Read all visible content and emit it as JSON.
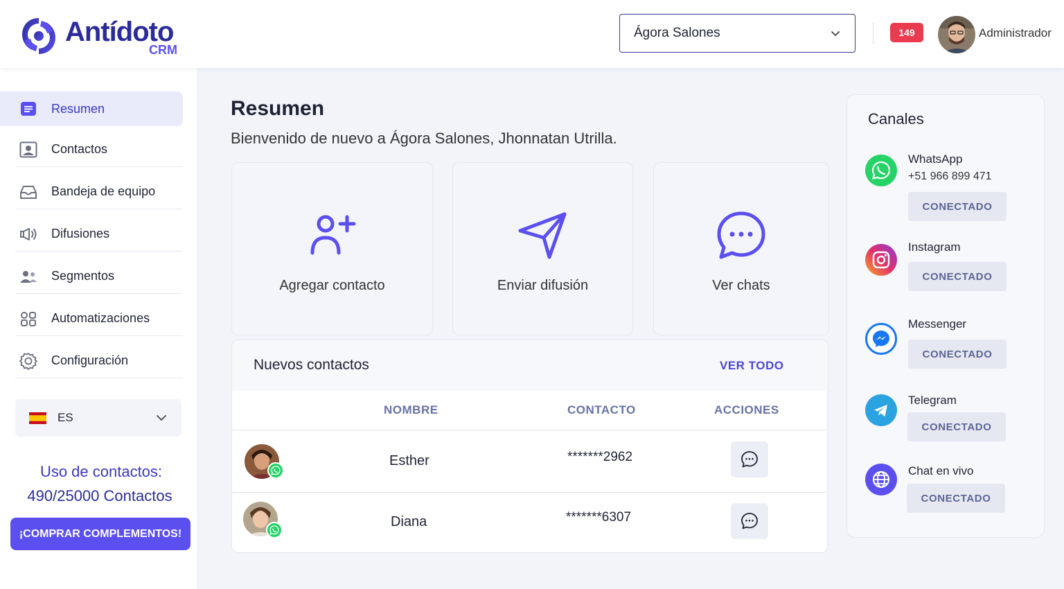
{
  "header": {
    "brand_name": "Antídoto",
    "brand_sub": "CRM",
    "salon_selected": "Ágora Salones",
    "notifications_count": "149",
    "user_name": "Administrador"
  },
  "sidebar": {
    "items": [
      {
        "label": "Resumen",
        "icon": "summary-icon"
      },
      {
        "label": "Contactos",
        "icon": "contacts-icon"
      },
      {
        "label": "Bandeja de equipo",
        "icon": "inbox-icon"
      },
      {
        "label": "Difusiones",
        "icon": "broadcast-icon"
      },
      {
        "label": "Segmentos",
        "icon": "segments-icon"
      },
      {
        "label": "Automatizaciones",
        "icon": "automations-icon"
      },
      {
        "label": "Configuración",
        "icon": "gear-icon"
      }
    ],
    "language_code": "ES",
    "usage_title": "Uso de contactos:",
    "usage_count": "490/25000 Contactos",
    "buy_button": "¡COMPRAR COMPLEMENTOS!"
  },
  "main": {
    "title": "Resumen",
    "welcome": "Bienvenido de nuevo a Ágora Salones, Jhonnatan Utrilla.",
    "actions": [
      {
        "label": "Agregar contacto",
        "icon": "add-user-icon"
      },
      {
        "label": "Enviar difusión",
        "icon": "send-icon"
      },
      {
        "label": "Ver chats",
        "icon": "chat-icon"
      }
    ],
    "new_contacts": {
      "title": "Nuevos contactos",
      "see_all": "VER TODO",
      "columns": [
        "NOMBRE",
        "CONTACTO",
        "ACCIONES"
      ],
      "rows": [
        {
          "name": "Esther",
          "phone": "*******2962",
          "channel": "whatsapp"
        },
        {
          "name": "Diana",
          "phone": "*******6307",
          "channel": "whatsapp"
        }
      ]
    }
  },
  "channels": {
    "title": "Canales",
    "items": [
      {
        "name": "WhatsApp",
        "phone": "+51 966 899 471",
        "status": "CONECTADO",
        "color": "#25d366"
      },
      {
        "name": "Instagram",
        "status": "CONECTADO",
        "color": "#e1306c"
      },
      {
        "name": "Messenger",
        "status": "CONECTADO",
        "color": "#1877f2"
      },
      {
        "name": "Telegram",
        "status": "CONECTADO",
        "color": "#2aa3e0"
      },
      {
        "name": "Chat en vivo",
        "status": "CONECTADO",
        "color": "#5b4fef"
      }
    ]
  },
  "colors": {
    "accent": "#5b4fef",
    "brand": "#2b2c9a",
    "badge": "#ea3b4f"
  }
}
